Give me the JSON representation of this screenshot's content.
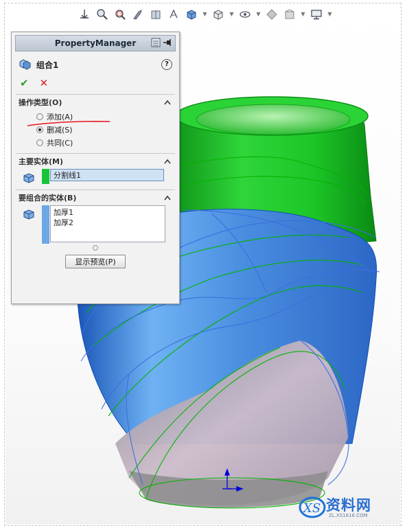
{
  "heads_up_toolbar": {
    "icons": [
      "view-orientation-icon",
      "zoom-to-fit-icon",
      "zoom-to-area-icon",
      "previous-view-icon",
      "section-view-icon",
      "view-selector-icon",
      "display-style-icon",
      "hide-show-items-icon",
      "edit-appearance-icon",
      "apply-scene-icon",
      "view-settings-icon",
      "display-monitor-icon"
    ]
  },
  "property_manager": {
    "title": "PropertyManager",
    "feature_name": "组合1",
    "help_symbol": "?",
    "ok_symbol": "✔",
    "cancel_symbol": "✕",
    "operation_group": {
      "title": "操作类型(O)",
      "options": [
        "添加(A)",
        "删减(S)",
        "共同(C)"
      ],
      "selected": "删减(S)"
    },
    "main_body_group": {
      "title": "主要实体(M)",
      "value": "分割线1",
      "color": "#19c43a"
    },
    "bodies_to_combine_group": {
      "title": "要组合的实体(B)",
      "items": [
        "加厚1",
        "加厚2"
      ],
      "color": "#6ba8e6"
    },
    "preview_button": "显示预览(P)"
  },
  "colors": {
    "green_body": "#1fbf2a",
    "blue_body": "#4a8ee0",
    "pink_surface": "#c7b4c6",
    "edge_green": "#00b400",
    "annotation_red": "#e8141e"
  },
  "watermark": {
    "brand": "资料网",
    "url": "ZL.XS1616.COM"
  }
}
